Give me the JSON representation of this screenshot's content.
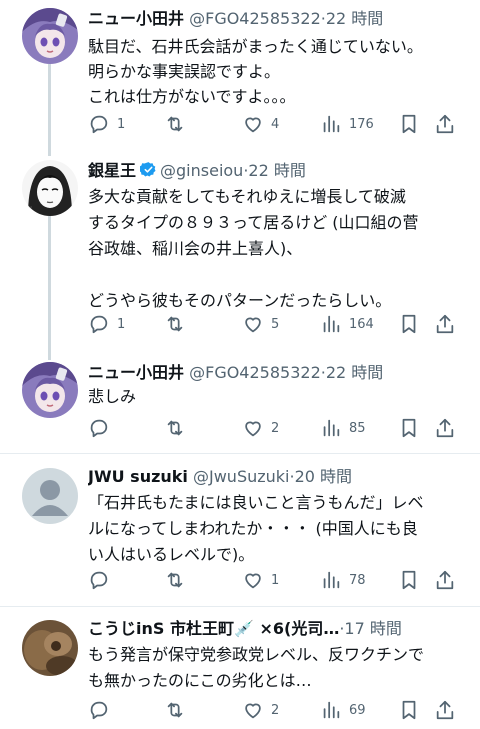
{
  "tweets": [
    {
      "name": "ニュー小田井",
      "handle": "@FGO42585322",
      "dot": "·",
      "time": "22 時間",
      "text": "駄目だ、石井氏会話がまったく通じていない。\n明らかな事実誤認ですよ。\nこれは仕方がないですよ。。。",
      "reply_count": "1",
      "retweet_count": "",
      "like_count": "4",
      "view_count": "176"
    },
    {
      "name": "銀星王",
      "handle": "@ginseiou",
      "dot": "·",
      "time": "22 時間",
      "verified": true,
      "text": "多大な貢献をしてもそれゆえに増長して破滅\nするタイプの８９３って居るけど (山口組の菅\n谷政雄、稲川会の井上喜人)、\n\nどうやら彼もそのパターンだったらしい。",
      "reply_count": "1",
      "retweet_count": "",
      "like_count": "5",
      "view_count": "164"
    },
    {
      "name": "ニュー小田井",
      "handle": "@FGO42585322",
      "dot": "·",
      "time": "22 時間",
      "text": "悲しみ",
      "reply_count": "",
      "retweet_count": "",
      "like_count": "2",
      "view_count": "85"
    },
    {
      "name": "JWU suzuki",
      "handle": "@JwuSuzuki",
      "dot": "·",
      "time": "20 時間",
      "text": "「石井氏もたまには良いこと言うもんだ」レベ\nルになってしまわれたか・・・ (中国人にも良\nい人はいるレベルで)。",
      "reply_count": "",
      "retweet_count": "",
      "like_count": "1",
      "view_count": "78"
    },
    {
      "name": "こうじinS 市杜王町💉 ×6(光司…",
      "handle": "",
      "dot": "·",
      "time": "17 時間",
      "text": "もう発言が保守党参政党レベル、反ワクチンで\nも無かったのにこの劣化とは…",
      "reply_count": "",
      "retweet_count": "",
      "like_count": "2",
      "view_count": "69"
    }
  ],
  "colors": {
    "text_primary": "#0f1419",
    "text_secondary": "#536471",
    "verified_blue": "#1d9bf0",
    "thread_line": "#cfd9de",
    "divider": "#e6ecf0",
    "avatar_purple": "#9a88c8",
    "avatar_gray": "#cfd9de"
  },
  "icons": [
    "reply-icon",
    "retweet-icon",
    "like-icon",
    "views-icon",
    "bookmark-icon",
    "share-icon",
    "verified-badge-icon",
    "default-avatar-icon"
  ]
}
